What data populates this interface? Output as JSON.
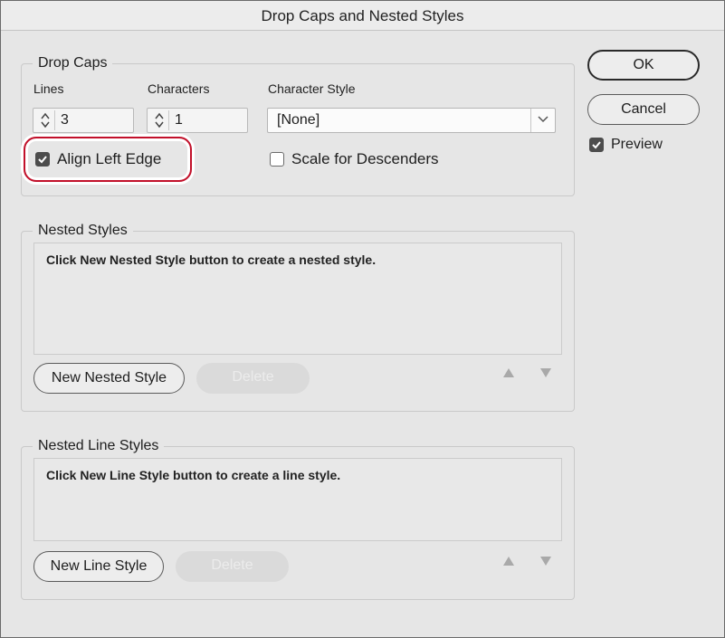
{
  "window": {
    "title": "Drop Caps and Nested Styles"
  },
  "drop_caps": {
    "group_label": "Drop Caps",
    "lines_label": "Lines",
    "lines_value": "3",
    "characters_label": "Characters",
    "characters_value": "1",
    "char_style_label": "Character Style",
    "char_style_value": "[None]",
    "align_left_edge": {
      "label": "Align Left Edge",
      "checked": true
    },
    "scale_descenders": {
      "label": "Scale for Descenders",
      "checked": false
    }
  },
  "nested_styles": {
    "group_label": "Nested Styles",
    "empty_text": "Click New Nested Style button to create a nested style.",
    "new_button": "New Nested Style",
    "delete_button": "Delete"
  },
  "nested_line_styles": {
    "group_label": "Nested Line Styles",
    "empty_text": "Click New Line Style button to create a line style.",
    "new_button": "New Line Style",
    "delete_button": "Delete"
  },
  "actions": {
    "ok": "OK",
    "cancel": "Cancel",
    "preview": {
      "label": "Preview",
      "checked": true
    }
  },
  "colors": {
    "highlight": "#c2102a",
    "dialog_bg": "#e6e6e6"
  }
}
